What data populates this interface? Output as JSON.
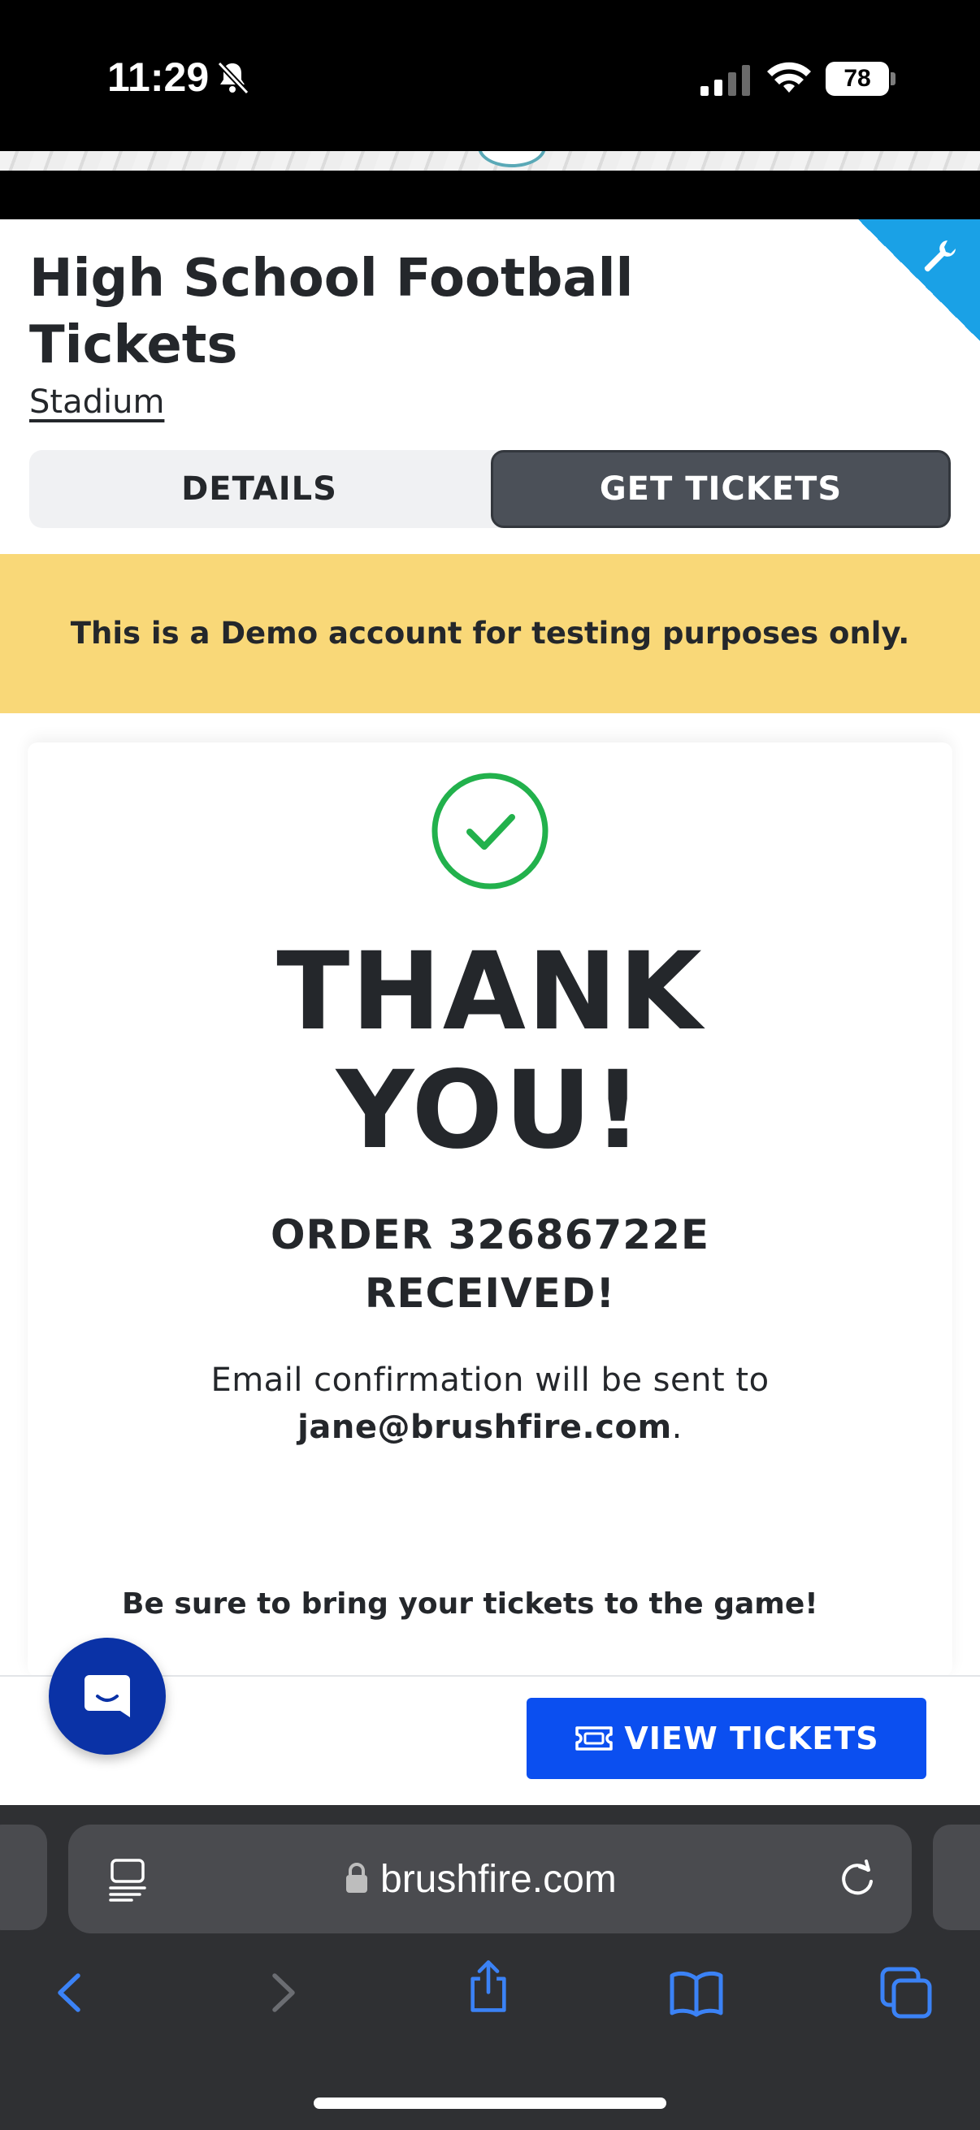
{
  "status_bar": {
    "time": "11:29",
    "battery": "78",
    "icons": [
      "bell-slash-icon",
      "signal-icon",
      "wifi-icon",
      "battery-icon"
    ]
  },
  "event": {
    "title": "High School Football Tickets",
    "venue": "Stadium"
  },
  "tabs": [
    {
      "label": "DETAILS",
      "active": false
    },
    {
      "label": "GET TICKETS",
      "active": true
    }
  ],
  "demo_notice": "This is a Demo account for testing purposes only.",
  "confirmation": {
    "headline": "THANK YOU!",
    "order_line": "ORDER 32686722E RECEIVED!",
    "email_prefix": "Email confirmation will be sent to",
    "email": "jane@brushfire.com",
    "email_suffix": ".",
    "reminder": "Be sure to bring your tickets to the game!"
  },
  "actions": {
    "view_tickets_label": "VIEW TICKETS"
  },
  "browser": {
    "url": "brushfire.com"
  },
  "colors": {
    "accent_blue": "#0b4ff0",
    "success_green": "#22b14c",
    "demo_yellow": "#f9d878",
    "active_tab": "#4b5058",
    "chat_blue": "#0a32a6",
    "admin_corner": "#1aa1e6"
  }
}
